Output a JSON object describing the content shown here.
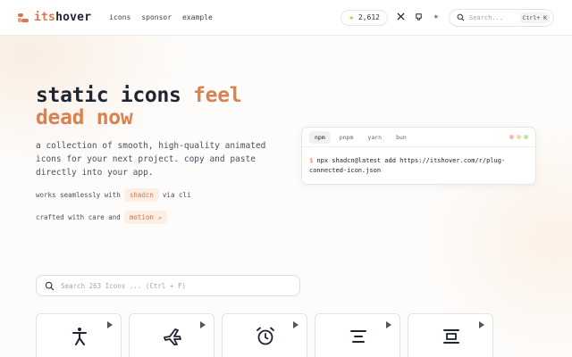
{
  "brand": {
    "name_accent": "its",
    "name_rest": "hover"
  },
  "nav": [
    "icons",
    "sponsor",
    "example"
  ],
  "header": {
    "stars": "2,612",
    "search_placeholder": "Search...",
    "search_shortcut": "Ctrl+ K"
  },
  "hero": {
    "title_line1_a": "static icons ",
    "title_line1_b": "feel",
    "title_line2": "dead now",
    "description": "a collection of smooth, high-quality animated icons for your next project. copy and paste directly into your app.",
    "works_prefix": "works seamlessly with",
    "works_chip": "shadcn",
    "works_suffix": "via cli",
    "crafted_prefix": "crafted with care and",
    "crafted_chip": "motion ↗"
  },
  "terminal": {
    "tabs": [
      "npm",
      "pnpm",
      "yarn",
      "bun"
    ],
    "active_tab": "npm",
    "prompt": "$",
    "command": "npx shadcn@latest add https://itshover.com/r/plug-connected-icon.json"
  },
  "icon_search": {
    "placeholder": "Search 263 Icons ... (Ctrl + F)"
  },
  "cards": [
    {
      "icon": "accessible-icon"
    },
    {
      "icon": "plane-icon"
    },
    {
      "icon": "alarm-clock-icon"
    },
    {
      "icon": "align-center-icon"
    },
    {
      "icon": "align-box-center-icon"
    }
  ],
  "colors": {
    "accent": "#d9774a",
    "star": "#e8b423",
    "dot_red": "#f2b8ae",
    "dot_yellow": "#f3d9a4",
    "dot_green": "#bfe0b6"
  }
}
